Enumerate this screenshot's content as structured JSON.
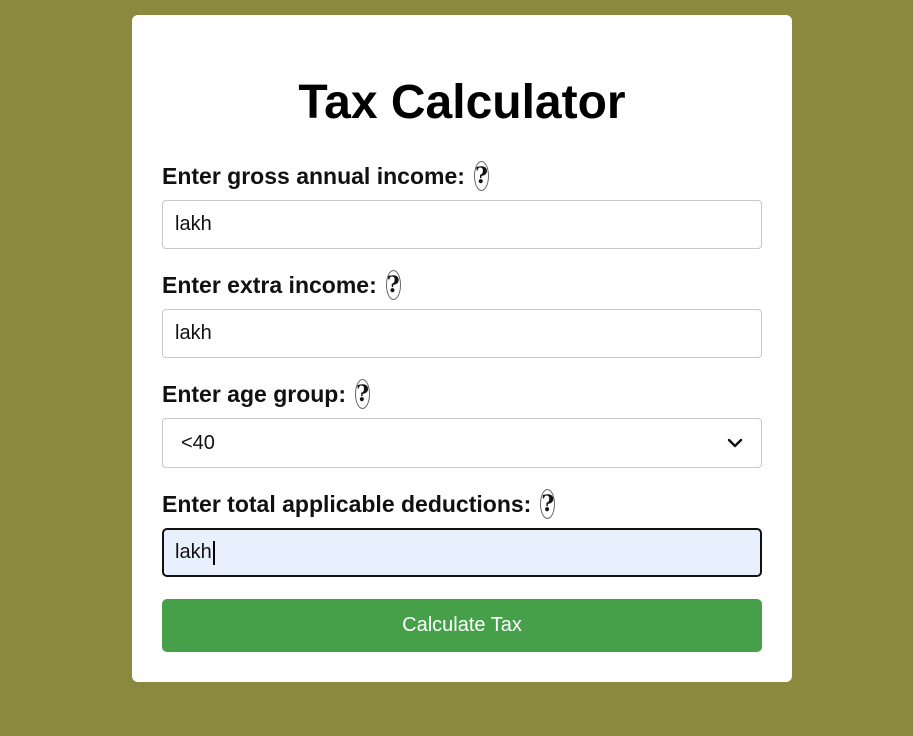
{
  "form": {
    "title": "Tax Calculator",
    "gross_income": {
      "label": "Enter gross annual income:",
      "help": "?",
      "value": "lakh"
    },
    "extra_income": {
      "label": "Enter extra income:",
      "help": "?",
      "value": "lakh"
    },
    "age_group": {
      "label": "Enter age group:",
      "help": "?",
      "selected": "<40"
    },
    "deductions": {
      "label": "Enter total applicable deductions:",
      "help": "?",
      "value": "lakh"
    },
    "submit_label": "Calculate Tax"
  },
  "colors": {
    "page_background": "#8b893e",
    "button": "#46a04a",
    "focused_input_background": "#e8f0fe"
  }
}
